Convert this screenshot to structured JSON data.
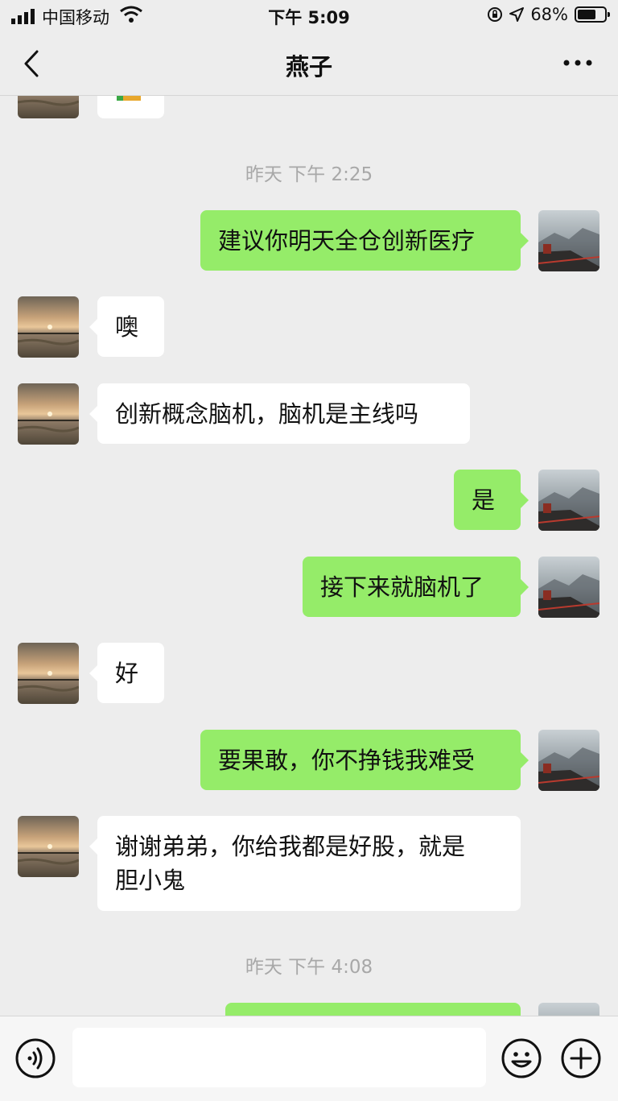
{
  "status_bar": {
    "carrier": "中国移动",
    "time": "下午 5:09",
    "battery": "68%",
    "battery_level": 0.68
  },
  "header": {
    "title": "燕子",
    "back_icon": "chevron-left-icon",
    "more_icon": "more-dots-icon"
  },
  "messages": [
    {
      "side": "left",
      "type": "sticker-partial"
    },
    {
      "type": "timestamp",
      "text": "昨天 下午 2:25"
    },
    {
      "side": "right",
      "text": "建议你明天全仓创新医疗"
    },
    {
      "side": "left",
      "text": "噢"
    },
    {
      "side": "left",
      "text": "创新概念脑机，脑机是主线吗"
    },
    {
      "side": "right",
      "text": "是"
    },
    {
      "side": "right",
      "text": "接下来就脑机了"
    },
    {
      "side": "left",
      "text": "好"
    },
    {
      "side": "right",
      "text": "要果敢，你不挣钱我难受"
    },
    {
      "side": "left",
      "text": "谢谢弟弟，你给我都是好股，就是\n胆小鬼"
    },
    {
      "type": "timestamp",
      "text": "昨天 下午 4:08"
    },
    {
      "side": "right",
      "text": "",
      "partial": true
    }
  ],
  "input_bar": {
    "value": "",
    "voice_icon": "voice-icon",
    "emoji_icon": "emoji-icon",
    "plus_icon": "plus-icon"
  }
}
